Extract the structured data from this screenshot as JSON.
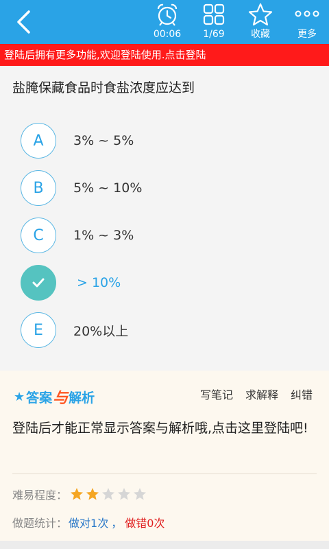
{
  "toolbar": {
    "timer": "00:06",
    "progress": "1/69",
    "favorite_label": "收藏",
    "more_label": "更多"
  },
  "banner": {
    "text": "登陆后拥有更多功能,欢迎登陆使用.点击登陆"
  },
  "question": {
    "text": "盐腌保藏食品时食盐浓度应达到",
    "options": [
      {
        "letter": "A",
        "text": "3% ~ 5%",
        "selected": false
      },
      {
        "letter": "B",
        "text": "5% ~ 10%",
        "selected": false
      },
      {
        "letter": "C",
        "text": "1% ~ 3%",
        "selected": false
      },
      {
        "letter": "D",
        "text": "> 10%",
        "selected": true
      },
      {
        "letter": "E",
        "text": "20%以上",
        "selected": false
      }
    ]
  },
  "answer_panel": {
    "title_star": "★",
    "title_part1": "答案",
    "title_connector": "与",
    "title_part2": "解析",
    "actions": [
      "写笔记",
      "求解释",
      "纠错"
    ],
    "login_message": "登陆后才能正常显示答案与解析哦,点击这里登陆吧!",
    "difficulty_label": "难易程度：",
    "difficulty_rating": 2,
    "difficulty_max": 5,
    "stats_label": "做题统计：",
    "stats_correct": "做对1次",
    "stats_sep": "，",
    "stats_wrong": "做错0次"
  },
  "colors": {
    "accent": "#2aa3e6",
    "banner": "#ff1a1a",
    "checked": "#55c3c0",
    "star_on": "#f5a623",
    "star_off": "#d6d6d6"
  },
  "icons": {
    "back": "chevron-left-icon",
    "timer": "alarm-clock-icon",
    "progress": "grid-icon",
    "favorite": "star-outline-icon",
    "more": "dots-icon",
    "checked": "checkmark-icon"
  }
}
